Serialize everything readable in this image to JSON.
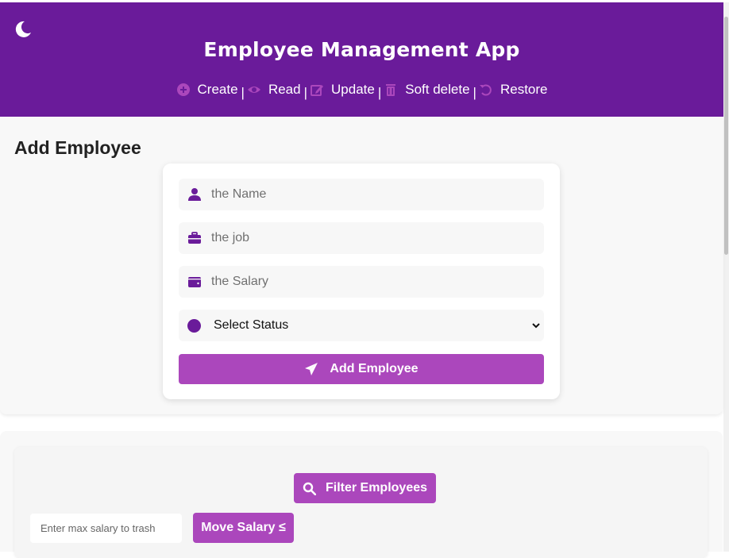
{
  "header": {
    "title": "Employee Management App",
    "theme_toggle_icon": "moon-icon",
    "nav": [
      {
        "label": "Create",
        "icon": "plus-circle-icon"
      },
      {
        "label": "Read",
        "icon": "eye-icon"
      },
      {
        "label": "Update",
        "icon": "edit-icon"
      },
      {
        "label": "Soft delete",
        "icon": "trash-icon"
      },
      {
        "label": "Restore",
        "icon": "undo-icon"
      }
    ],
    "separator": "|"
  },
  "add_section": {
    "title": "Add Employee",
    "name_placeholder": "the Name",
    "job_placeholder": "the job",
    "salary_placeholder": "the Salary",
    "status_selected": "Select Status",
    "submit_label": "Add Employee"
  },
  "filter_section": {
    "filter_label": "Filter Employees",
    "max_salary_placeholder": "Enter max salary to trash",
    "move_label": "Move Salary ≤"
  },
  "colors": {
    "header_bg": "#6a1b9a",
    "accent": "#ab47bc",
    "icon_color": "#6a1b9a"
  }
}
